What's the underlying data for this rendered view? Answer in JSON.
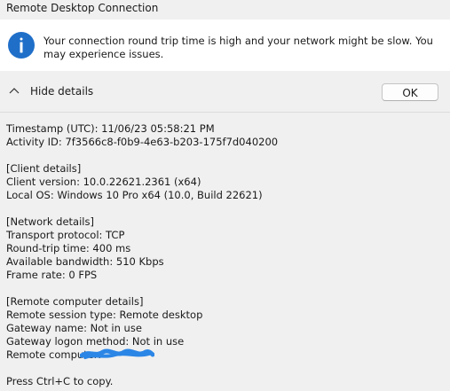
{
  "window": {
    "title": "Remote Desktop Connection"
  },
  "message": {
    "icon": "info-icon",
    "text": "Your connection round trip time is high and your network might be slow. You may experience issues."
  },
  "details_toggle": {
    "icon": "chevron-up-icon",
    "label": "Hide details"
  },
  "ok_button": {
    "label": "OK"
  },
  "details": {
    "timestamp": "Timestamp (UTC): 11/06/23 05:58:21 PM",
    "activity_id": "Activity ID: 7f3566c8-f0b9-4e63-b203-175f7d040200",
    "client_header": "[Client details]",
    "client_version": "Client version: 10.0.22621.2361 (x64)",
    "local_os": "Local OS: Windows 10 Pro x64 (10.0, Build 22621)",
    "network_header": "[Network details]",
    "transport_protocol": "Transport protocol: TCP",
    "round_trip_time": "Round-trip time: 400 ms",
    "available_bandwidth": "Available bandwidth: 510 Kbps",
    "frame_rate": "Frame rate: 0 FPS",
    "remote_header": "[Remote computer details]",
    "remote_session_type": "Remote session type: Remote desktop",
    "gateway_name": "Gateway name: Not in use",
    "gateway_logon_method": "Gateway logon method: Not in use",
    "remote_computer": "Remote computer:",
    "copy_hint": "Press Ctrl+C to copy."
  },
  "colors": {
    "accent": "#1f6fc9",
    "redaction": "#2b86e6",
    "background": "#f0f0f0",
    "message_background": "#ffffff"
  }
}
